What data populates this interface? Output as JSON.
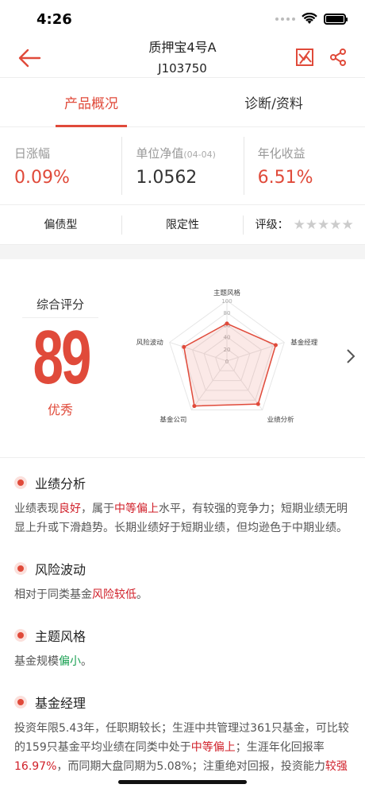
{
  "status": {
    "time": "4:26"
  },
  "header": {
    "title": "质押宝4号A",
    "code": "J103750"
  },
  "tabs": [
    {
      "label": "产品概况",
      "active": true
    },
    {
      "label": "诊断/资料",
      "active": false
    }
  ],
  "stats": [
    {
      "label": "日涨幅",
      "note": "",
      "value": "0.09%"
    },
    {
      "label": "单位净值",
      "note": "(04-04)",
      "value": "1.0562"
    },
    {
      "label": "年化收益",
      "note": "",
      "value": "6.51%"
    }
  ],
  "tags": {
    "type": "偏债型",
    "category": "限定性",
    "rating_label": "评级：",
    "stars": "★★★★★"
  },
  "score": {
    "label": "综合评分",
    "value": "89",
    "grade": "优秀"
  },
  "chart_data": {
    "type": "radar",
    "axes": [
      "主题风格",
      "基金经理",
      "业绩分析",
      "基金公司",
      "风险波动"
    ],
    "ticks": [
      "100",
      "80",
      "60",
      "40",
      "20",
      "0"
    ],
    "values": [
      62,
      85,
      88,
      92,
      75
    ],
    "range": [
      0,
      100
    ]
  },
  "sections": [
    {
      "title": "业绩分析",
      "segments": [
        {
          "t": "业绩表现",
          "c": ""
        },
        {
          "t": "良好",
          "c": "red"
        },
        {
          "t": "，属于",
          "c": ""
        },
        {
          "t": "中等偏上",
          "c": "red"
        },
        {
          "t": "水平，有较强的竞争力；短期业绩无明显上升或下滑趋势。长期业绩好于短期业绩，但均逊色于中期业绩。",
          "c": ""
        }
      ]
    },
    {
      "title": "风险波动",
      "segments": [
        {
          "t": "相对于同类基金",
          "c": ""
        },
        {
          "t": "风险较低",
          "c": "red"
        },
        {
          "t": "。",
          "c": ""
        }
      ]
    },
    {
      "title": "主题风格",
      "segments": [
        {
          "t": "基金规模",
          "c": ""
        },
        {
          "t": "偏小",
          "c": "green"
        },
        {
          "t": "。",
          "c": ""
        }
      ]
    },
    {
      "title": "基金经理",
      "segments": [
        {
          "t": "投资年限5.43年，任职期较长；生涯中共管理过361只基金，可比较的159只基金平均业绩在同类中处于",
          "c": ""
        },
        {
          "t": "中等偏上",
          "c": "red"
        },
        {
          "t": "；生涯年化回报率",
          "c": ""
        },
        {
          "t": "16.97%",
          "c": "red"
        },
        {
          "t": "，而同期大盘同期为5.08%；注重绝对回报，投资能力",
          "c": ""
        },
        {
          "t": "较强",
          "c": "red"
        }
      ]
    }
  ],
  "colors": {
    "accent": "#e04a3a",
    "green": "#1aa052"
  },
  "icons": {
    "back": "back-arrow-icon",
    "chart": "chart-icon",
    "share": "share-icon",
    "chevron": "chevron-right-icon"
  }
}
